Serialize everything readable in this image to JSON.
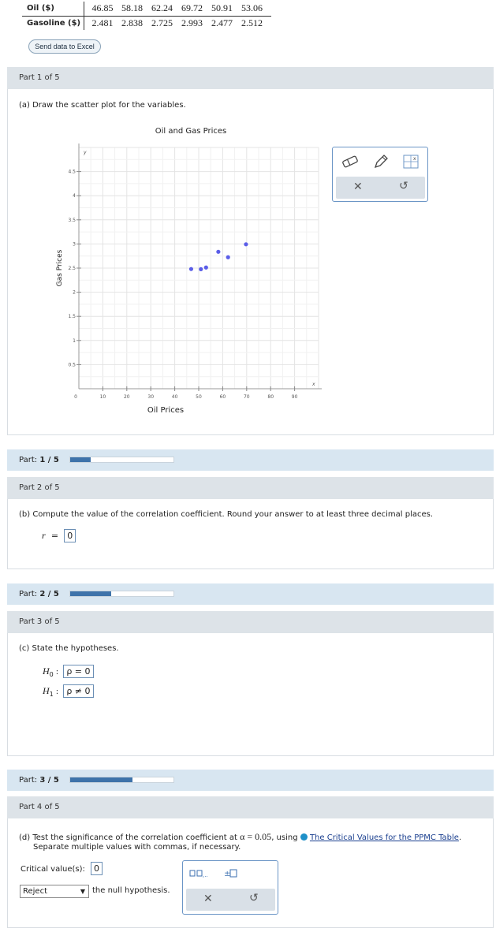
{
  "table": {
    "rows": [
      {
        "label": "Oil ($)",
        "values": [
          "46.85",
          "58.18",
          "62.24",
          "69.72",
          "50.91",
          "53.06"
        ]
      },
      {
        "label": "Gasoline ($)",
        "values": [
          "2.481",
          "2.838",
          "2.725",
          "2.993",
          "2.477",
          "2.512"
        ]
      }
    ]
  },
  "excel_button": "Send data to Excel",
  "part1": {
    "header": "Part 1 of 5",
    "question": "(a) Draw the scatter plot for the variables.",
    "progress_label": "Part:",
    "progress_value": "1 / 5",
    "progress_fraction": 0.2
  },
  "chart_data": {
    "type": "scatter",
    "title": "Oil and Gas Prices",
    "xlabel": "Oil Prices",
    "ylabel": "Gas Prices",
    "x_axis_letter": "x",
    "y_axis_letter": "y",
    "xlim": [
      0,
      100
    ],
    "ylim": [
      0,
      5
    ],
    "x_ticks": [
      "10",
      "20",
      "30",
      "40",
      "50",
      "60",
      "70",
      "80",
      "90"
    ],
    "y_ticks": [
      "0.5",
      "1",
      "1.5",
      "2",
      "2.5",
      "3",
      "3.5",
      "4",
      "4.5"
    ],
    "origin_label": "0",
    "grid": true,
    "points": [
      {
        "x": 46.85,
        "y": 2.481
      },
      {
        "x": 58.18,
        "y": 2.838
      },
      {
        "x": 62.24,
        "y": 2.725
      },
      {
        "x": 69.72,
        "y": 2.993
      },
      {
        "x": 50.91,
        "y": 2.477
      },
      {
        "x": 53.06,
        "y": 2.512
      }
    ],
    "point_color": "#5b5ee8"
  },
  "part2": {
    "header": "Part 2 of 5",
    "question": "(b) Compute the value of the correlation coefficient. Round your answer to at least three decimal places.",
    "r_symbol": "r",
    "equals": "=",
    "r_value": "0",
    "progress_label": "Part:",
    "progress_value": "2 / 5",
    "progress_fraction": 0.4
  },
  "part3": {
    "header": "Part 3 of 5",
    "question": "(c) State the hypotheses.",
    "h0_label": "H",
    "h0_sub": "0",
    "h0_value": "ρ = 0",
    "h1_label": "H",
    "h1_sub": "1",
    "h1_value": "ρ ≠ 0",
    "colon": ":",
    "progress_label": "Part:",
    "progress_value": "3 / 5",
    "progress_fraction": 0.6
  },
  "part4": {
    "header": "Part 4 of 5",
    "question_prefix": "(d) Test the significance of the correlation coefficient at",
    "alpha": "α = 0.05",
    "question_mid": ", using",
    "table_link": "The Critical Values for the PPMC Table",
    "question_suffix": ".",
    "question_line2": "Separate multiple values with commas, if necessary.",
    "critical_label": "Critical value(s):",
    "critical_value": "0",
    "decision_selected": "Reject",
    "decision_suffix": "the null hypothesis."
  },
  "colors": {
    "header_bg": "#dde3e8",
    "progress_bg": "#d8e6f1",
    "progress_fill": "#3e73aa",
    "toolbox_border": "#6b95c6"
  }
}
